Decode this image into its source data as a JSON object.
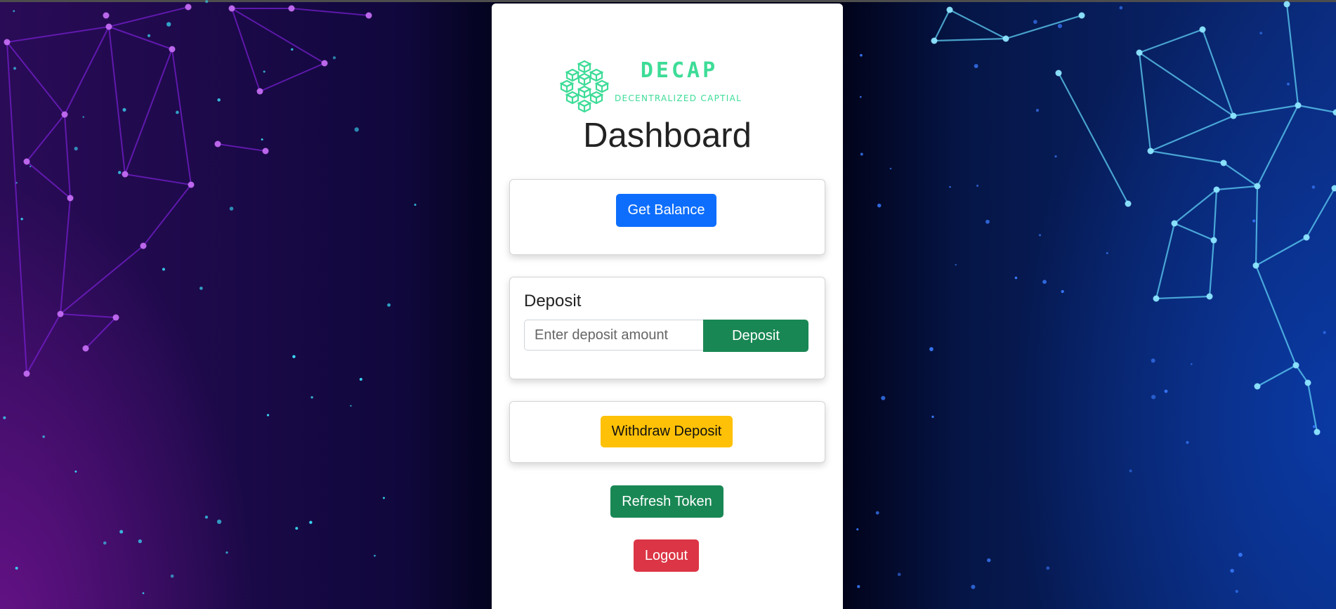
{
  "brand": {
    "name": "DECAP",
    "tagline": "DECENTRALIZED CAPTIAL",
    "logo_icon": "hexagonal-cubes-icon"
  },
  "page": {
    "title": "Dashboard"
  },
  "balance_card": {
    "button_label": "Get Balance"
  },
  "deposit_card": {
    "label": "Deposit",
    "input_placeholder": "Enter deposit amount",
    "input_value": "",
    "button_label": "Deposit"
  },
  "withdraw_card": {
    "button_label": "Withdraw Deposit"
  },
  "actions": {
    "refresh_label": "Refresh Token",
    "logout_label": "Logout"
  },
  "colors": {
    "primary": "#0d6efd",
    "success": "#198754",
    "warning": "#ffc107",
    "danger": "#dc3545",
    "brand_green": "#3ddc97",
    "background_left": "#7a1fd6",
    "background_right": "#5fd0f5"
  }
}
